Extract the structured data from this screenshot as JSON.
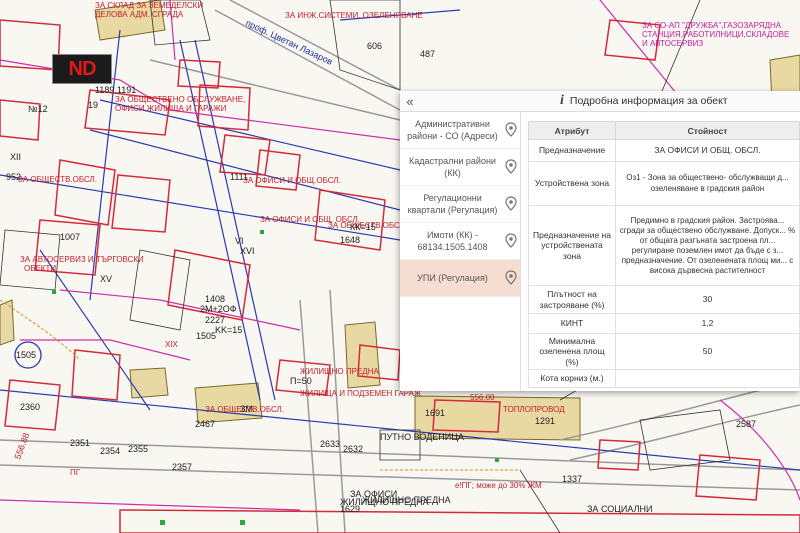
{
  "panel": {
    "title": "Подробна информация за обект",
    "collapse_icon": "chevron-double-left",
    "sidebar": [
      {
        "label": "Административни райони - СО (Адреси)",
        "active": false
      },
      {
        "label": "Кадастрални райони (КК)",
        "active": false
      },
      {
        "label": "Регулационни квартали (Регулация)",
        "active": false
      },
      {
        "label": "Имоти (КК) - 68134.1505.1408",
        "active": false
      },
      {
        "label": "УПИ (Регулация)",
        "active": true
      }
    ],
    "table_headers": {
      "attr": "Атрибут",
      "value": "Стойност"
    },
    "rows": [
      {
        "attr": "Предназначение",
        "value": "ЗА ОФИСИ И ОБЩ. ОБСЛ."
      },
      {
        "attr": "Устройствена зона",
        "value": "Оз1 - Зона за обществено- обслужващи д... озеленяване в градския район"
      },
      {
        "attr": "Предназначение на устройствената зона",
        "value": "Предимно в градския район. Застроява... сгради за обществено обслужване. Допуск... % от общата разгъната застроена пл... регулиране поземлен имот да бъде с з... предназначение. От озеленената площ ми... с висока дървесна растителност"
      },
      {
        "attr": "Плътност на застрояване (%)",
        "value": "30"
      },
      {
        "attr": "КИНТ",
        "value": "1,2"
      },
      {
        "attr": "Минимална озеленена площ (%)",
        "value": "50"
      },
      {
        "attr": "Кота корниз (м.)",
        "value": ""
      }
    ]
  },
  "map": {
    "logo": "ND",
    "labels": [
      "ЗА СКЛАД ЗА ЗЕМЕДЕЛСКИ",
      "ДЕЛОВА АДМ. СГРАДА",
      "проф. Цветан Лазаров",
      "ЗА ИНЖ.СИСТЕМИ, ОЗЕЛЕНЯВАНЕ",
      "ЗА СО-АП \"ДРУЖБА\",ГАЗОЗАРЯДНА",
      "СТАНЦИЯ,РАБОТИЛНИЦИ,СКЛАДОВЕ",
      "И АВТОСЕРВИЗ",
      "606",
      "487",
      "1189.1191",
      "19",
      "ЗА ОБЩЕСТВЕНО ОБСЛУЖВАНЕ,",
      "ОФИСИ,ЖИЛИЩА И ГАРАЖИ",
      "№12",
      "XII",
      "952",
      "ЗА ОБЩЕСТВ.ОБСЛ.",
      "ЗА ОФИСИ И ОБЩ.ОБСЛ.",
      "ЗА ОФИСИ И ОБЩ. ОБСЛ.",
      "1111",
      "1648",
      "КК=15",
      "1408",
      "XVI",
      "VI",
      "2227",
      "KK=15",
      "2M+2ОФ",
      "2224",
      "1505",
      "1580",
      "2360",
      "2351",
      "2354",
      "2355",
      "2357",
      "1291",
      "1691",
      "1337",
      "2587",
      "2632",
      "2633",
      "2467",
      "1629",
      "П=50",
      "П=46",
      "Делийска воденица",
      "ПГ",
      "е!ПГ; може до 30% ЖМ",
      "ЗА ОФИСИ",
      "XV",
      "XIX",
      "ЗА ОБЩЕСТВ.ОБСЛ.",
      "ЗМ",
      "ПУТНО ВОДЕНИЦА",
      "ТОПЛОПРОВОД",
      "556.00",
      "556.88",
      "ЖИЛИЩНО ПРЕДНА",
      "ЗА СОЦИАЛНИ",
      "ЖИЛИЩА И ПОДЗЕМЕН ГАРАЖ",
      "ЗА АВТОСЕРВИЗ И ТЪРГОВСКИ",
      "ОБЕКТИ",
      "1007",
      "КК=15",
      "1409"
    ]
  },
  "colors": {
    "parcel_red": "#d42a3a",
    "reg_magenta": "#cc2faa",
    "street_blue": "#2a3bb0",
    "building_yellow": "#e9d9a0",
    "active_tab": "#f6ddd1"
  }
}
